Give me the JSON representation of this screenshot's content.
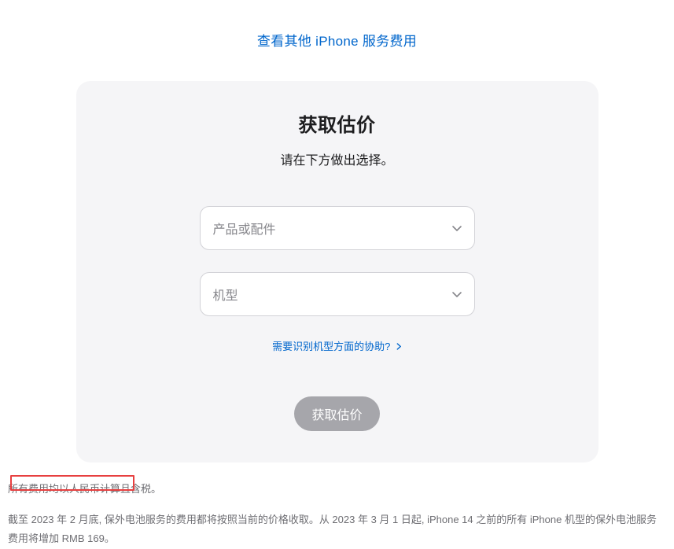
{
  "topLink": {
    "label": "查看其他 iPhone 服务费用"
  },
  "card": {
    "title": "获取估价",
    "subtitle": "请在下方做出选择。",
    "select1": {
      "placeholder": "产品或配件"
    },
    "select2": {
      "placeholder": "机型"
    },
    "helpLink": {
      "label": "需要识别机型方面的协助?"
    },
    "button": {
      "label": "获取估价"
    }
  },
  "footer": {
    "line1": "所有费用均以人民币计算且含税。",
    "line2": "截至 2023 年 2 月底, 保外电池服务的费用都将按照当前的价格收取。从 2023 年 3 月 1 日起, iPhone 14 之前的所有 iPhone 机型的保外电池服务费用将增加 RMB 169。"
  }
}
